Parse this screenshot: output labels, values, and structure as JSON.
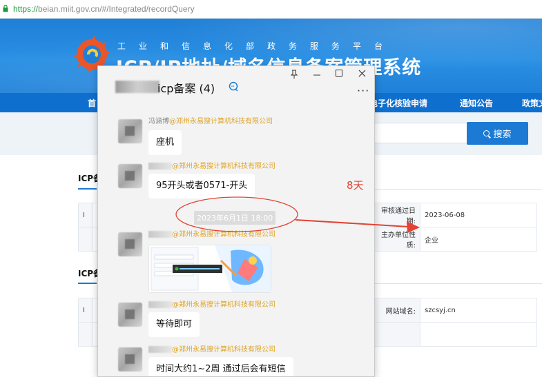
{
  "browser": {
    "url_protocol": "https://",
    "url_rest": "beian.miit.gov.cn/#/Integrated/recordQuery"
  },
  "site": {
    "subtitle": "工业和信息化部政务服务平台",
    "title": "ICP/IP地址/域名信息备案管理系统",
    "nav": [
      "首",
      "电子化核验申请",
      "通知公告",
      "政策文"
    ],
    "search_button": "搜索"
  },
  "records": {
    "section1_title": "ICP备",
    "section2_title": "ICP备",
    "row1_label": "审核通过日期:",
    "row1_value": "2023-06-08",
    "row2_label": "主办单位性质:",
    "row2_value": "企业",
    "row3_label": "网站域名:",
    "row3_value": "szcsyj.cn",
    "left_marker": "I"
  },
  "chat": {
    "group_name": "icp备案 (4)",
    "messages": [
      {
        "sender": "冯涵博",
        "company": "@郑州永易搜计算机科技有限公司",
        "text": "座机"
      },
      {
        "sender": "",
        "company": "@郑州永易搜计算机科技有限公司",
        "text": "95开头或者0571-开头"
      },
      {
        "sender": "",
        "company": "@郑州永易搜计算机科技有限公司",
        "text": ""
      },
      {
        "sender": "",
        "company": "@郑州永易搜计算机科技有限公司",
        "text": "等待即可"
      },
      {
        "sender": "",
        "company": "@郑州永易搜计算机科技有限公司",
        "text": "时间大约1~2周 通过后会有短信"
      }
    ],
    "timestamp": "2023年6月1日 18:00"
  },
  "annotation": {
    "label": "8天",
    "color": "#e34234"
  }
}
